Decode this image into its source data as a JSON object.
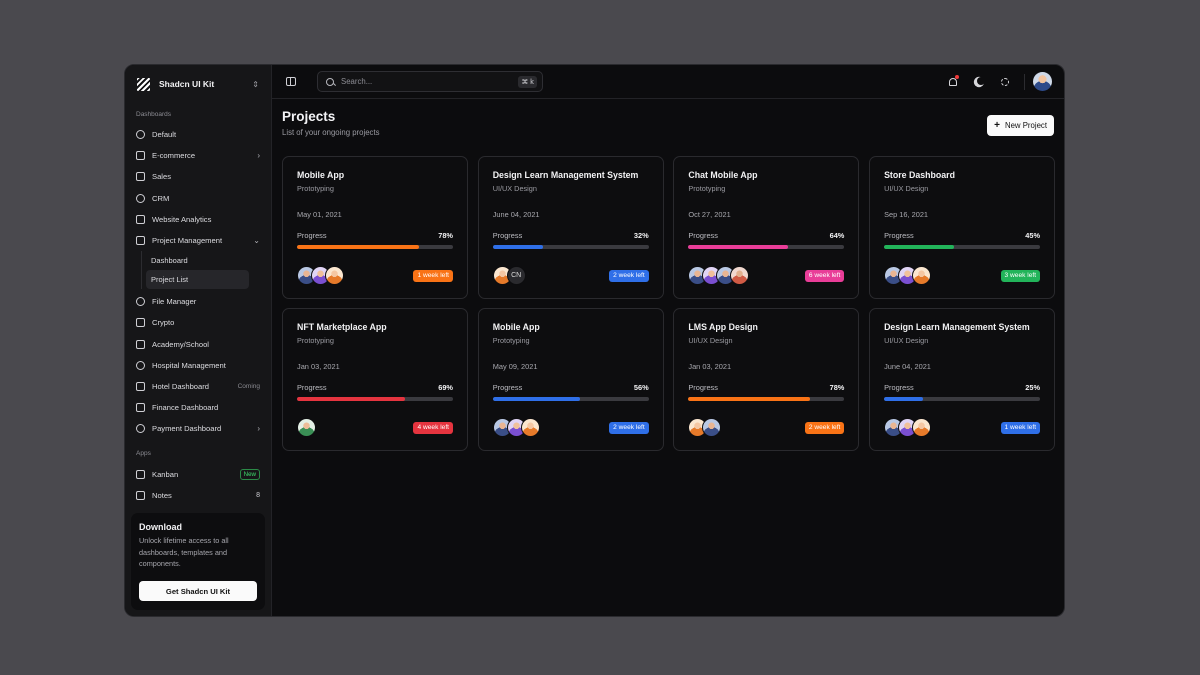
{
  "colors": {
    "orange": "#f97316",
    "blue": "#2f6fe8",
    "pink": "#e93d98",
    "green": "#22b45a",
    "red": "#e5343f"
  },
  "sidebar": {
    "brand": "Shadcn UI Kit",
    "dashboards_label": "Dashboards",
    "items": [
      {
        "label": "Default"
      },
      {
        "label": "E-commerce",
        "chevron": "›"
      },
      {
        "label": "Sales"
      },
      {
        "label": "CRM"
      },
      {
        "label": "Website Analytics"
      },
      {
        "label": "Project Management",
        "chevron": "⌄"
      }
    ],
    "sub_items": [
      {
        "label": "Dashboard"
      },
      {
        "label": "Project List"
      }
    ],
    "items2": [
      {
        "label": "File Manager"
      },
      {
        "label": "Crypto"
      },
      {
        "label": "Academy/School"
      },
      {
        "label": "Hospital Management"
      },
      {
        "label": "Hotel Dashboard",
        "meta": "Coming"
      },
      {
        "label": "Finance Dashboard"
      },
      {
        "label": "Payment Dashboard",
        "chevron": "›"
      }
    ],
    "apps_label": "Apps",
    "apps": [
      {
        "label": "Kanban",
        "badge": "New"
      },
      {
        "label": "Notes",
        "count": "8"
      }
    ],
    "download": {
      "title": "Download",
      "text": "Unlock lifetime access to all dashboards, templates and components.",
      "button": "Get Shadcn UI Kit"
    }
  },
  "topbar": {
    "search_placeholder": "Search...",
    "shortcut": "⌘ k"
  },
  "page": {
    "title": "Projects",
    "subtitle": "List of your ongoing projects",
    "new_button": "New Project"
  },
  "projects": [
    {
      "title": "Mobile App",
      "category": "Prototyping",
      "date": "May 01, 2021",
      "progress_label": "Progress",
      "progress": "78%",
      "progress_value": 78,
      "color": "#f97316",
      "deadline": "1 week left",
      "avatars": [
        "a1",
        "a2",
        "a3"
      ]
    },
    {
      "title": "Design Learn Management System",
      "category": "UI/UX Design",
      "date": "June 04, 2021",
      "progress_label": "Progress",
      "progress": "32%",
      "progress_value": 32,
      "color": "#2f6fe8",
      "deadline": "2 week left",
      "avatars": [
        "a3",
        "cn"
      ]
    },
    {
      "title": "Chat Mobile App",
      "category": "Prototyping",
      "date": "Oct 27, 2021",
      "progress_label": "Progress",
      "progress": "64%",
      "progress_value": 64,
      "color": "#e93d98",
      "deadline": "6 week left",
      "avatars": [
        "a1",
        "a2",
        "a1",
        "a4"
      ]
    },
    {
      "title": "Store Dashboard",
      "category": "UI/UX Design",
      "date": "Sep 16, 2021",
      "progress_label": "Progress",
      "progress": "45%",
      "progress_value": 45,
      "color": "#22b45a",
      "deadline": "3 week left",
      "avatars": [
        "a1",
        "a2",
        "a3"
      ]
    },
    {
      "title": "NFT Marketplace App",
      "category": "Prototyping",
      "date": "Jan 03, 2021",
      "progress_label": "Progress",
      "progress": "69%",
      "progress_value": 69,
      "color": "#e5343f",
      "deadline": "4 week left",
      "avatars": [
        "a5"
      ]
    },
    {
      "title": "Mobile App",
      "category": "Prototyping",
      "date": "May 09, 2021",
      "progress_label": "Progress",
      "progress": "56%",
      "progress_value": 56,
      "color": "#2f6fe8",
      "deadline": "2 week left",
      "avatars": [
        "a1",
        "a2",
        "a3"
      ]
    },
    {
      "title": "LMS App Design",
      "category": "UI/UX Design",
      "date": "Jan 03, 2021",
      "progress_label": "Progress",
      "progress": "78%",
      "progress_value": 78,
      "color": "#f97316",
      "deadline": "2 week left",
      "avatars": [
        "a3",
        "a1"
      ]
    },
    {
      "title": "Design Learn Management System",
      "category": "UI/UX Design",
      "date": "June 04, 2021",
      "progress_label": "Progress",
      "progress": "25%",
      "progress_value": 25,
      "color": "#2f6fe8",
      "deadline": "1 week left",
      "avatars": [
        "a1",
        "a2",
        "a3"
      ]
    }
  ],
  "cn_label": "CN"
}
